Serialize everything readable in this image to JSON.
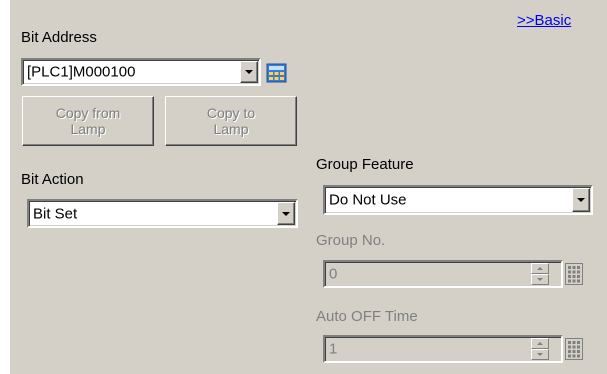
{
  "basic_link": ">>Basic",
  "bit_address": {
    "label": "Bit Address",
    "value": "[PLC1]M000100"
  },
  "copy_from_lamp": {
    "line1": "Copy from",
    "line2": "Lamp"
  },
  "copy_to_lamp": {
    "line1": "Copy to",
    "line2": "Lamp"
  },
  "bit_action": {
    "label": "Bit Action",
    "value": "Bit Set"
  },
  "group_feature": {
    "label": "Group Feature",
    "value": "Do Not Use"
  },
  "group_no": {
    "label": "Group No.",
    "value": "0"
  },
  "auto_off_time": {
    "label": "Auto OFF Time",
    "value": "1"
  },
  "colors": {
    "panel": "#d4d0c8",
    "link": "#0000ee",
    "disabled_text": "#808080"
  }
}
